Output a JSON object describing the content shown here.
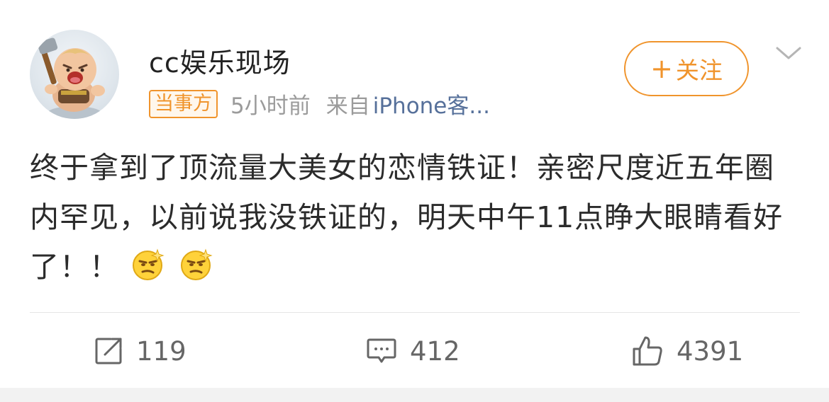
{
  "post": {
    "author": {
      "name": "cc娱乐现场",
      "avatar": "baby-warrior-avatar",
      "badge": "当事方",
      "time": "5小时前",
      "source_prefix": "来自",
      "source_name": "iPhone客..."
    },
    "follow_label": "关注",
    "follow_icon": "plus-icon",
    "menu_icon": "chevron-down-icon",
    "text": "终于拿到了顶流量大美女的恋情铁证！亲密尺度近五年圈内罕见，以前说我没铁证的，明天中午11点睁大眼睛看好了！！",
    "emojis": [
      "smirk-emoji",
      "smirk-emoji"
    ],
    "actions": {
      "repost": {
        "icon": "repost-icon",
        "count": "119"
      },
      "comment": {
        "icon": "comment-icon",
        "count": "412"
      },
      "like": {
        "icon": "like-icon",
        "count": "4391"
      }
    }
  },
  "colors": {
    "accent": "#f0942c",
    "link": "#56709a",
    "meta": "#9b9b9b",
    "text": "#2b2b2b"
  }
}
